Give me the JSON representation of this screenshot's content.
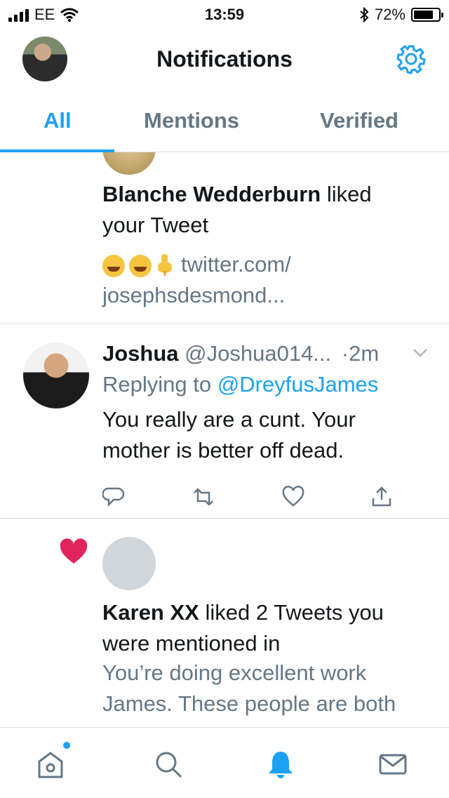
{
  "status_bar": {
    "carrier": "EE",
    "time": "13:59",
    "battery": "72%"
  },
  "header": {
    "title": "Notifications"
  },
  "tabs": [
    {
      "label": "All",
      "active": true
    },
    {
      "label": "Mentions",
      "active": false
    },
    {
      "label": "Verified",
      "active": false
    }
  ],
  "notifications": [
    {
      "type": "like",
      "user": "Blanche Wedderburn",
      "action": " liked",
      "action_line2": "your Tweet",
      "preview_link": "twitter.com/",
      "preview_line2": "josephsdesmond..."
    },
    {
      "type": "reply",
      "name": "Joshua",
      "handle": "@Joshua014...",
      "time": "·2m",
      "replying_to_prefix": "Replying to ",
      "replying_to_user": "@DreyfusJames",
      "text_line1": "You really are a cunt. Your",
      "text_line2": "mother is better off dead."
    },
    {
      "type": "like",
      "user": "Karen XX",
      "action": " liked 2 Tweets you",
      "action_line2": "were mentioned in",
      "preview_line1": "You’re doing excellent work",
      "preview_line2": "James. These people are both"
    }
  ],
  "icons": {
    "signal": "signal-icon",
    "wifi": "wifi-icon",
    "bluetooth": "bluetooth-icon",
    "battery": "battery-icon",
    "settings": "gear-icon",
    "reply": "reply-icon",
    "retweet": "retweet-icon",
    "like": "heart-outline-icon",
    "share": "share-icon",
    "liked": "heart-filled-icon",
    "home": "home-icon",
    "search": "search-icon",
    "notifications": "bell-icon",
    "messages": "mail-icon"
  },
  "colors": {
    "accent": "#1da1f2",
    "like": "#e0245e",
    "muted": "#657786",
    "text": "#14171a"
  }
}
